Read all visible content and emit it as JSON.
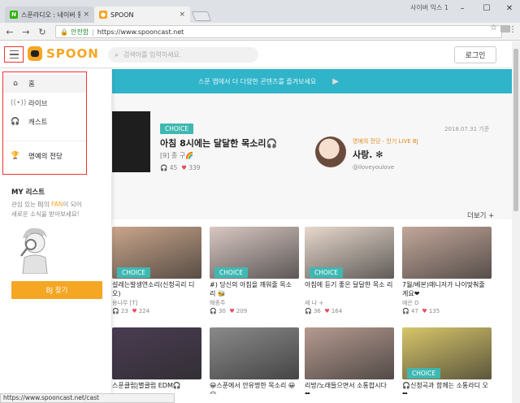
{
  "browser": {
    "tabs": [
      {
        "label": "스푼라디오 : 네이버 통합",
        "favicon": "naver-icon",
        "active": false
      },
      {
        "label": "SPOON",
        "favicon": "spoon-icon",
        "active": true
      }
    ],
    "window_user": "사이버 익스 1",
    "address": {
      "secure_label": "안전함",
      "url": "https://www.spooncast.net"
    },
    "status_url": "https://www.spooncast.net/cast"
  },
  "header": {
    "logo_text": "SPOON",
    "search_placeholder": "검색어를 입력하세요.",
    "login_label": "로그인"
  },
  "sidebar": {
    "items": [
      {
        "label": "홈",
        "icon": "home-icon"
      },
      {
        "label": "라이브",
        "icon": "live-icon"
      },
      {
        "label": "캐스트",
        "icon": "headphones-icon"
      },
      {
        "label": "명예의 전당",
        "icon": "trophy-icon"
      }
    ],
    "my_list_title": "MY 리스트",
    "my_list_desc_line1_a": "관심 있는 BJ의 ",
    "my_list_desc_fan": "FAN",
    "my_list_desc_line1_b": "이 되어",
    "my_list_desc_line2": "새로운 소식을 받아보세요!",
    "find_bj_label": "BJ 찾기"
  },
  "banner": {
    "text": "스푼 앱에서 더 다양한 콘텐츠를 즐겨보세요"
  },
  "feature": {
    "choice_label": "CHOICE",
    "title": "아침 8시에는 달달한 목소리🎧",
    "subtitle": "[9] 종 구🌈",
    "plays": "45",
    "likes": "339",
    "date": "2018.07.31 기준",
    "hof_label": "명예의 전당 - 인기 LIVE BJ",
    "hof_name": "사랑. ✻",
    "hof_handle": "@iloveyoulove"
  },
  "more_label": "더보기 +",
  "cards": [
    {
      "title": "설레는발생연소리(신청곡리 디오)",
      "user": "용나무 [T]",
      "plays": "23",
      "likes": "224",
      "choice": "CHOICE",
      "color": "#c9a58a"
    },
    {
      "title": "#) 당신의 아침을 깨워줄 목소 리 🐝",
      "user": "해종주",
      "plays": "30",
      "likes": "209",
      "choice": "CHOICE",
      "color": "#d8c7c2"
    },
    {
      "title": "아침에 듣기 좋은 달달한 목소 리",
      "user": "세 나 +",
      "plays": "36",
      "likes": "164",
      "choice": "CHOICE",
      "color": "#e7d8cc"
    },
    {
      "title": "7월/베본)매니저가 나이맞춰줄 게요❤",
      "user": "예은 D",
      "plays": "47",
      "likes": "135",
      "choice": "",
      "color": "#c3a79a"
    },
    {
      "title": "스푼클럽|별클럽 EDM🎧",
      "user": "",
      "plays": "",
      "likes": "",
      "choice": "",
      "color": "#4a3c52"
    },
    {
      "title": "😀스푼에서 안유명한 목소리 😀😀",
      "user": "",
      "plays": "",
      "likes": "",
      "choice": "",
      "color": "#8a8a8a"
    },
    {
      "title": "리방/노래들으면서 소통합시다 ❤",
      "user": "",
      "plays": "",
      "likes": "",
      "choice": "",
      "color": "#b59a8f"
    },
    {
      "title": "🎧신청곡과 함께는 소통라디 오❤",
      "user": "",
      "plays": "",
      "likes": "",
      "choice": "CHOICE",
      "color": "#d7c56a"
    }
  ]
}
